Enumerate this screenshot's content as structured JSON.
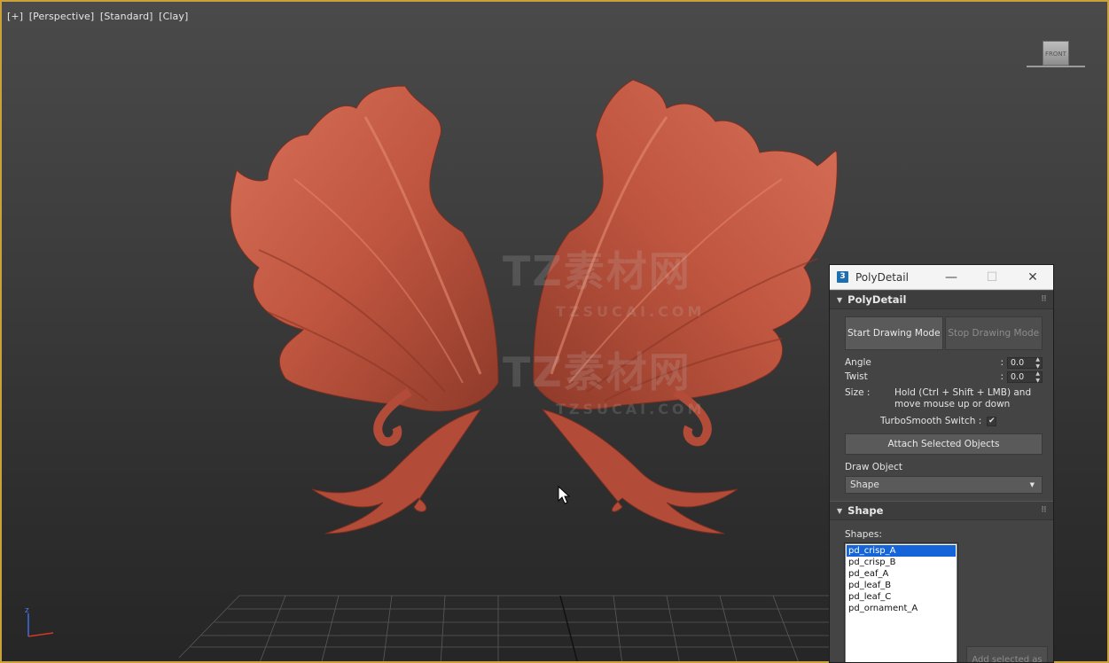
{
  "viewport": {
    "label_parts": [
      "[+]",
      "[Perspective]",
      "[Standard]",
      "[Clay]"
    ],
    "viewcube_label": "FRONT",
    "axis_label": "z",
    "watermark": {
      "text_big": "TZ素材网",
      "text_small": "TZSUCAI.COM"
    }
  },
  "panel": {
    "title": "PolyDetail",
    "app_icon": "3",
    "window_controls": {
      "minimize": "—",
      "maximize": "☐",
      "close": "✕"
    },
    "polydetail_rollout": {
      "header": "PolyDetail",
      "start_drawing": "Start Drawing Mode",
      "stop_drawing": "Stop Drawing Mode",
      "angle_label": "Angle",
      "angle_value": "0.0",
      "twist_label": "Twist",
      "twist_value": "0.0",
      "size_label": "Size :",
      "size_text": "Hold (Ctrl + Shift + LMB) and move mouse up or down",
      "turbosmooth_label": "TurboSmooth Switch :",
      "turbosmooth_checked": "✔",
      "attach_button": "Attach Selected Objects",
      "draw_object_label": "Draw Object",
      "draw_object_value": "Shape"
    },
    "shape_rollout": {
      "header": "Shape",
      "shapes_label": "Shapes:",
      "shapes": [
        "pd_crisp_A",
        "pd_crisp_B",
        "pd_eaf_A",
        "pd_leaf_B",
        "pd_leaf_C",
        "pd_ornament_A"
      ],
      "selected_index": 0,
      "add_button": "Add selected as"
    }
  },
  "colors": {
    "accent_border": "#c9a33a",
    "model_clay": "#c55a44",
    "selection": "#1565d8"
  }
}
